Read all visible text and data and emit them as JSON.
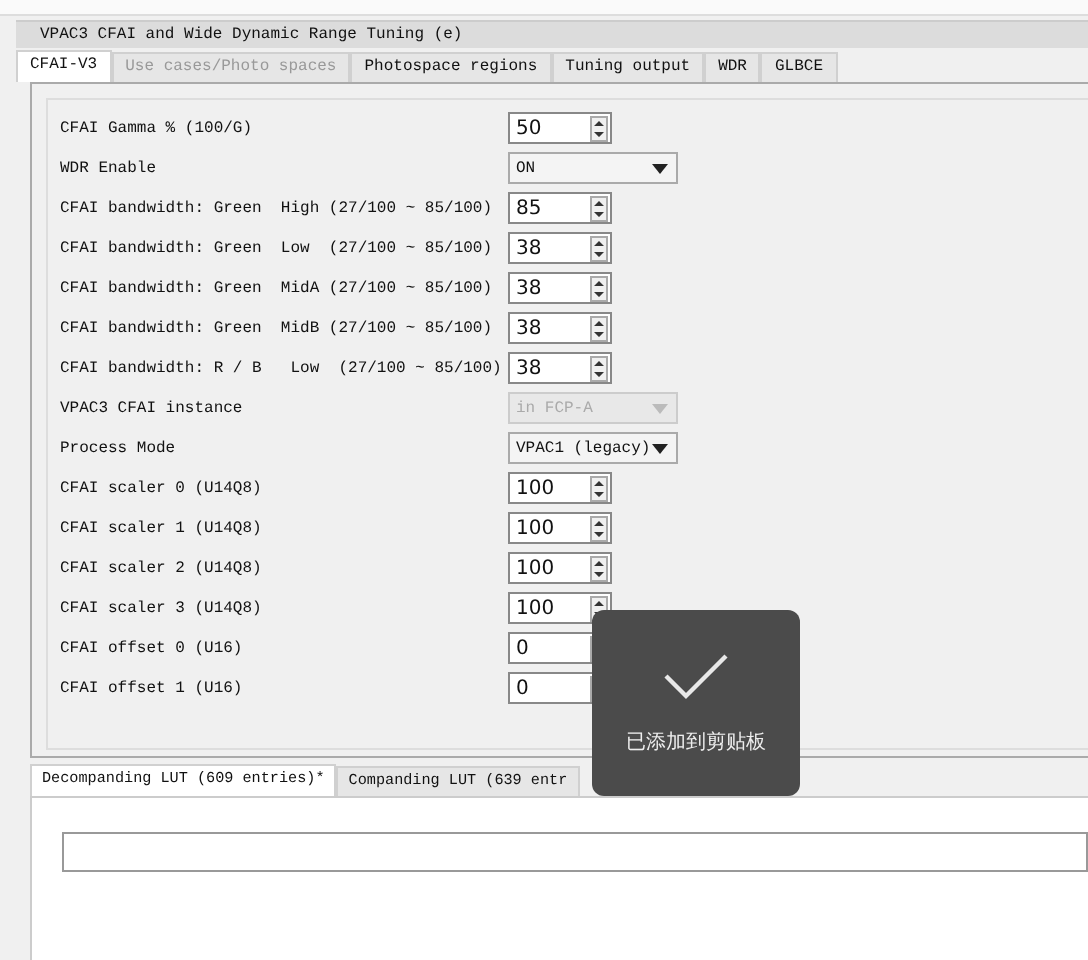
{
  "window": {
    "title": "VPAC3 CFAI and Wide Dynamic Range Tuning (e)"
  },
  "tabs": [
    {
      "label": "CFAI-V3",
      "selected": true,
      "disabled": false
    },
    {
      "label": "Use cases/Photo spaces",
      "selected": false,
      "disabled": true
    },
    {
      "label": "Photospace regions",
      "selected": false,
      "disabled": false
    },
    {
      "label": "Tuning output",
      "selected": false,
      "disabled": false
    },
    {
      "label": "WDR",
      "selected": false,
      "disabled": false
    },
    {
      "label": "GLBCE",
      "selected": false,
      "disabled": false
    }
  ],
  "settings": [
    {
      "label": "CFAI Gamma % (100/G)",
      "kind": "spin",
      "value": "50",
      "disabled": false
    },
    {
      "label": "WDR Enable",
      "kind": "select",
      "value": "ON",
      "disabled": false
    },
    {
      "label": "CFAI bandwidth: Green  High (27/100 ~ 85/100)",
      "kind": "spin",
      "value": "85",
      "disabled": false
    },
    {
      "label": "CFAI bandwidth: Green  Low  (27/100 ~ 85/100)",
      "kind": "spin",
      "value": "38",
      "disabled": false
    },
    {
      "label": "CFAI bandwidth: Green  MidA (27/100 ~ 85/100)",
      "kind": "spin",
      "value": "38",
      "disabled": false
    },
    {
      "label": "CFAI bandwidth: Green  MidB (27/100 ~ 85/100)",
      "kind": "spin",
      "value": "38",
      "disabled": false
    },
    {
      "label": "CFAI bandwidth: R / B   Low  (27/100 ~ 85/100)",
      "kind": "spin",
      "value": "38",
      "disabled": false
    },
    {
      "label": "VPAC3 CFAI instance",
      "kind": "select",
      "value": "in FCP-A",
      "disabled": true
    },
    {
      "label": "Process Mode",
      "kind": "select",
      "value": "VPAC1 (legacy)",
      "disabled": false
    },
    {
      "label": "CFAI scaler 0 (U14Q8)",
      "kind": "spin",
      "value": "100",
      "disabled": false
    },
    {
      "label": "CFAI scaler 1 (U14Q8)",
      "kind": "spin",
      "value": "100",
      "disabled": false
    },
    {
      "label": "CFAI scaler 2 (U14Q8)",
      "kind": "spin",
      "value": "100",
      "disabled": false
    },
    {
      "label": "CFAI scaler 3 (U14Q8)",
      "kind": "spin",
      "value": "100",
      "disabled": false
    },
    {
      "label": "CFAI offset 0 (U16)",
      "kind": "spin",
      "value": "0",
      "disabled": false
    },
    {
      "label": "CFAI offset 1 (U16)",
      "kind": "spin",
      "value": "0",
      "disabled": false
    }
  ],
  "lut_tabs": [
    {
      "label": "Decompanding LUT (609 entries)*",
      "selected": true
    },
    {
      "label": "Companding LUT (639 entr",
      "selected": false
    }
  ],
  "toast": {
    "message": "已添加到剪贴板"
  }
}
